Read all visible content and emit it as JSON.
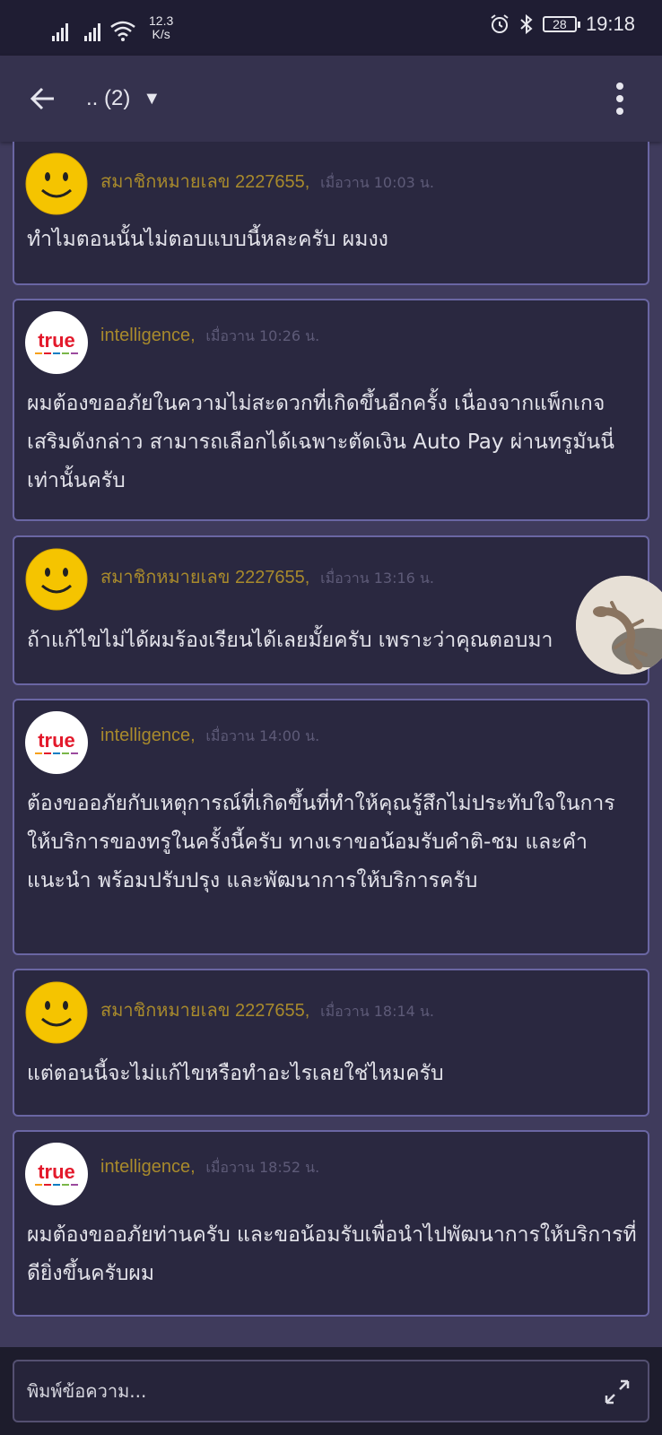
{
  "status_bar": {
    "net_speed_value": "12.3",
    "net_speed_unit": "K/s",
    "battery": "28",
    "time": "19:18"
  },
  "app_bar": {
    "title": ".. (2)",
    "dropdown_glyph": "▼"
  },
  "messages": [
    {
      "author": "สมาชิกหมายเลข 2227655,",
      "time": "เมื่อวาน  10:03 น.",
      "avatar": "smiley-avatar",
      "text": "ทำไมตอนนั้นไม่ตอบแบบนี้หละครับ ผมงง"
    },
    {
      "author": "intelligence,",
      "time": "เมื่อวาน  10:26 น.",
      "avatar": "true-logo-avatar",
      "text": "ผมต้องขออภัยในความไม่สะดวกที่เกิดขึ้นอีกครั้ง เนื่องจากแพ็กเกจเสริมดังกล่าว สามารถเลือกได้เฉพาะตัดเงิน Auto Pay ผ่านทรูมันนี่เท่านั้นครับ"
    },
    {
      "author": "สมาชิกหมายเลข 2227655,",
      "time": "เมื่อวาน  13:16 น.",
      "avatar": "smiley-avatar",
      "text": "ถ้าแก้ไขไม่ได้ผมร้องเรียนได้เลยมั้ยครับ เพราะว่าคุณตอบมา"
    },
    {
      "author": "intelligence,",
      "time": "เมื่อวาน  14:00 น.",
      "avatar": "true-logo-avatar",
      "text": "ต้องขออภัยกับเหตุการณ์ที่เกิดขึ้นที่ทำให้คุณรู้สึกไม่ประทับใจในการให้บริการของทรูในครั้งนี้ครับ ทางเราขอน้อมรับคำติ-ชม และคำแนะนำ พร้อมปรับปรุง และพัฒนาการให้บริการครับ"
    },
    {
      "author": "สมาชิกหมายเลข 2227655,",
      "time": "เมื่อวาน  18:14 น.",
      "avatar": "smiley-avatar",
      "text": "แต่ตอนนี้จะไม่แก้ไขหรือทำอะไรเลยใช่ไหมครับ"
    },
    {
      "author": "intelligence,",
      "time": "เมื่อวาน  18:52 น.",
      "avatar": "true-logo-avatar",
      "text": "ผมต้องขออภัยท่านครับ และขอน้อมรับเพื่อนำไปพัฒนาการให้บริการที่ดียิ่งขึ้นครับผม"
    }
  ],
  "true_logo_word": "true",
  "composer": {
    "placeholder": "พิมพ์ข้อความ..."
  },
  "colors": {
    "author": "#a88a2c",
    "card_border": "#6a66a3",
    "true_red": "#e3192b"
  }
}
